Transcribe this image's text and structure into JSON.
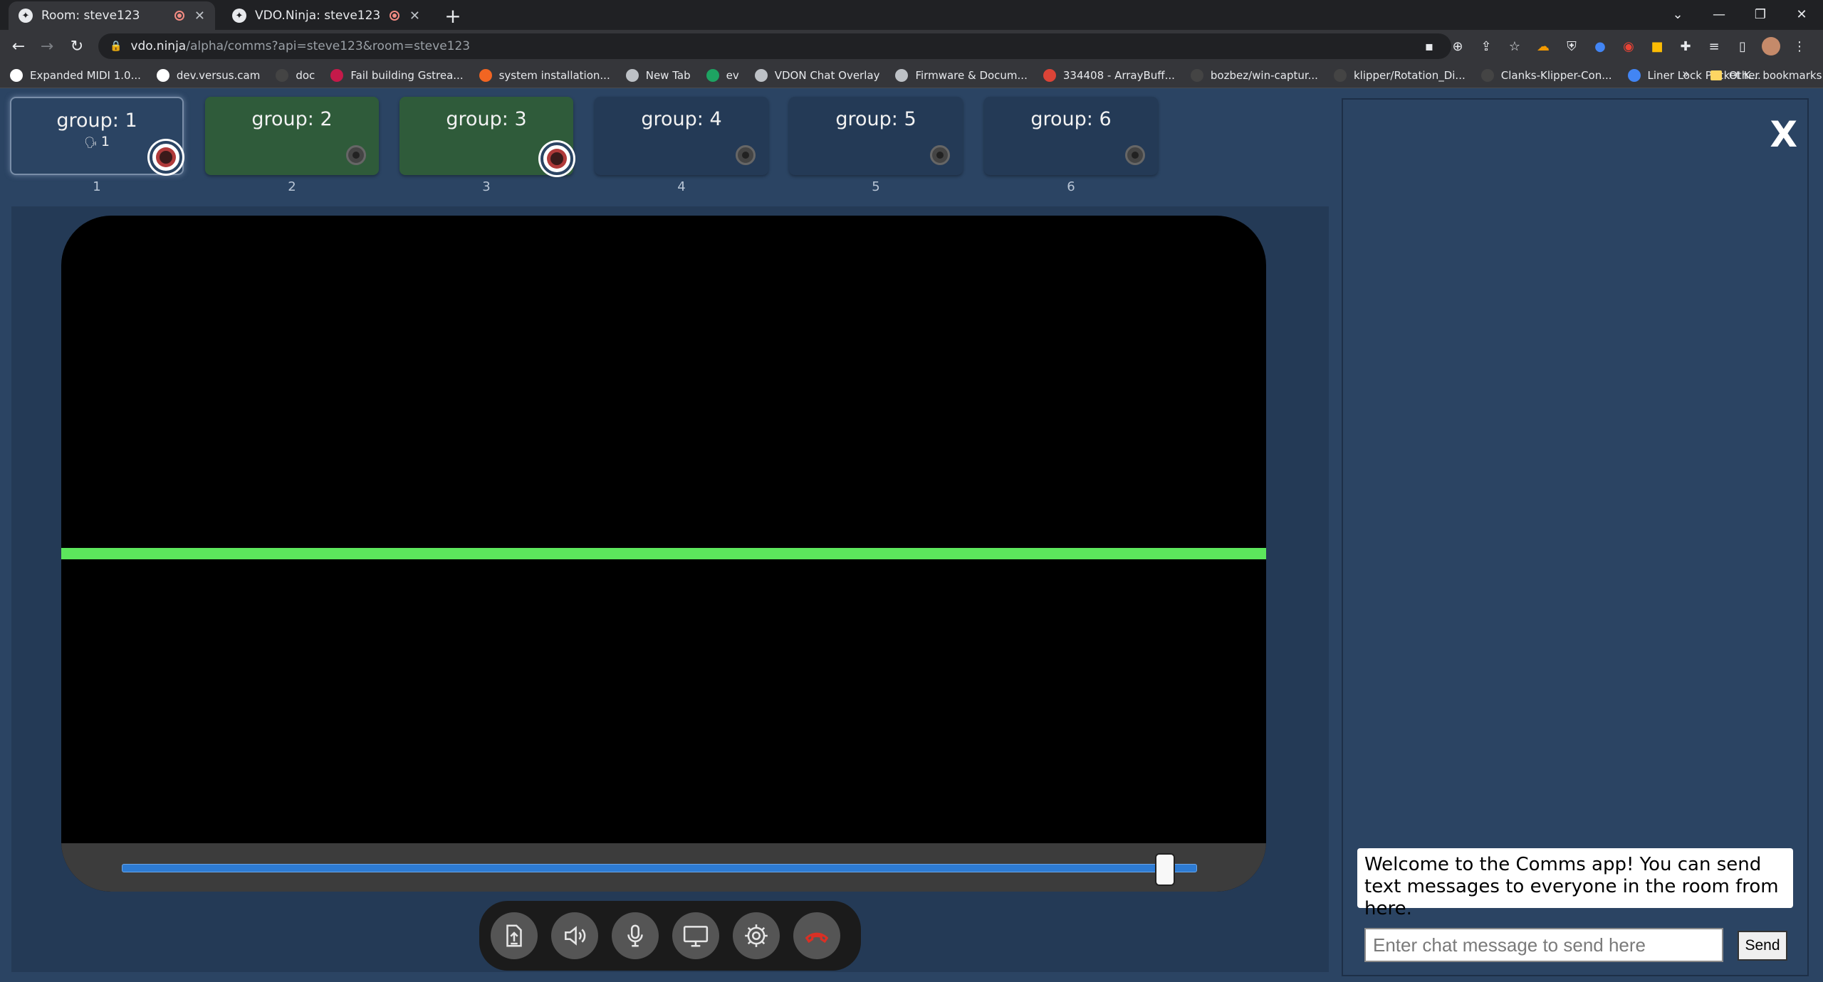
{
  "browser": {
    "tabs": [
      {
        "title": "Room: steve123",
        "active": true
      },
      {
        "title": "VDO.Ninja: steve123",
        "active": false
      }
    ],
    "url_host": "vdo.ninja",
    "url_path": "/alpha/comms?api=steve123&room=steve123",
    "bookmarks": [
      {
        "label": "Expanded MIDI 1.0...",
        "color": "#ffffff"
      },
      {
        "label": "dev.versus.cam",
        "color": "#ffffff"
      },
      {
        "label": "doc",
        "color": "#444444"
      },
      {
        "label": "Fail building Gstrea...",
        "color": "#c51a4a"
      },
      {
        "label": "system installation...",
        "color": "#f26522"
      },
      {
        "label": "New Tab",
        "color": "#bdc1c6"
      },
      {
        "label": "ev",
        "color": "#1ea362"
      },
      {
        "label": "VDON Chat Overlay",
        "color": "#bdc1c6"
      },
      {
        "label": "Firmware & Docum...",
        "color": "#bdc1c6"
      },
      {
        "label": "334408 - ArrayBuff...",
        "color": "#db4437"
      },
      {
        "label": "bozbez/win-captur...",
        "color": "#444444"
      },
      {
        "label": "klipper/Rotation_Di...",
        "color": "#444444"
      },
      {
        "label": "Clanks-Klipper-Con...",
        "color": "#444444"
      },
      {
        "label": "Liner Lock Pocket K...",
        "color": "#4285f4"
      }
    ],
    "more_bookmarks": "»",
    "other_bookmarks": "Other bookmarks"
  },
  "groups": [
    {
      "name": "group: 1",
      "count": "1",
      "number": "1",
      "state": "selected",
      "eye_on": true
    },
    {
      "name": "group: 2",
      "count": "",
      "number": "2",
      "state": "green",
      "eye_on": false
    },
    {
      "name": "group: 3",
      "count": "",
      "number": "3",
      "state": "green",
      "eye_on": true
    },
    {
      "name": "group: 4",
      "count": "",
      "number": "4",
      "state": "normal",
      "eye_on": false
    },
    {
      "name": "group: 5",
      "count": "",
      "number": "5",
      "state": "normal",
      "eye_on": false
    },
    {
      "name": "group: 6",
      "count": "",
      "number": "6",
      "state": "normal",
      "eye_on": false
    }
  ],
  "player": {
    "volume_fraction": 0.97,
    "controls": [
      "share-file-icon",
      "speaker-icon",
      "microphone-icon",
      "screen-share-icon",
      "settings-icon",
      "hangup-icon"
    ]
  },
  "chat": {
    "close_label": "X",
    "welcome": "Welcome to the Comms app! You can send text messages to everyone in the room from here.",
    "input_placeholder": "Enter chat message to send here",
    "send_label": "Send"
  },
  "colors": {
    "background": "#2b4463",
    "group_green": "#2f5b3a",
    "audio_line": "#5ce65c",
    "slider": "#2d7bd3",
    "hangup": "#d93025"
  }
}
